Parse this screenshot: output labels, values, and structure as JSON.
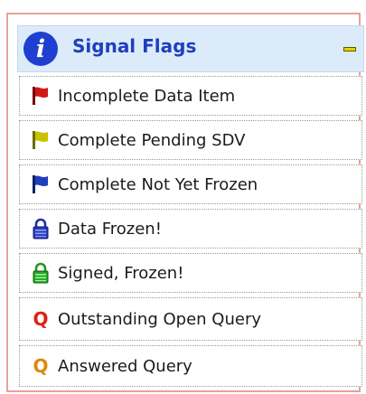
{
  "panel": {
    "title": "Signal Flags",
    "info_icon": "i",
    "items": [
      {
        "label": "Incomplete Data Item",
        "icon": "red-flag-icon",
        "color": "#d01818"
      },
      {
        "label": "Complete Pending SDV",
        "icon": "yellow-flag-icon",
        "color": "#c9c000"
      },
      {
        "label": "Complete Not Yet Frozen",
        "icon": "blue-flag-icon",
        "color": "#1f3fbf"
      },
      {
        "label": "Data Frozen!",
        "icon": "blue-lock-icon",
        "color": "#1f2fa8"
      },
      {
        "label": "Signed, Frozen!",
        "icon": "green-lock-icon",
        "color": "#1e9a1e"
      },
      {
        "label": "Outstanding Open Query",
        "icon": "red-query-icon",
        "glyph": "Q",
        "color": "#e02010"
      },
      {
        "label": "Answered Query",
        "icon": "orange-query-icon",
        "glyph": "Q",
        "color": "#d88a10"
      }
    ]
  }
}
